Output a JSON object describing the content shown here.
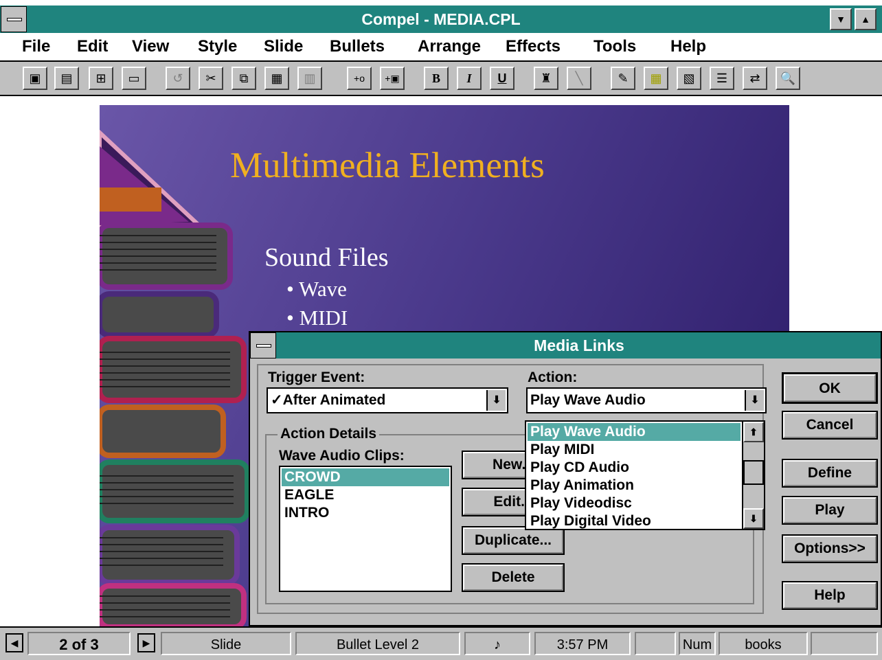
{
  "window": {
    "title": "Compel - MEDIA.CPL",
    "minimize_glyph": "▼",
    "maximize_glyph": "▲"
  },
  "menu": {
    "items": [
      {
        "label": "File"
      },
      {
        "label": "Edit"
      },
      {
        "label": "View"
      },
      {
        "label": "Style"
      },
      {
        "label": "Slide"
      },
      {
        "label": "Bullets"
      },
      {
        "label": "Arrange"
      },
      {
        "label": "Effects"
      },
      {
        "label": "Tools"
      },
      {
        "label": "Help"
      }
    ]
  },
  "toolbar": {
    "icons": [
      "save-icon",
      "print-preview-icon",
      "organize-icon",
      "drive-icon",
      "undo-icon",
      "cut-icon",
      "copy-icon",
      "paste-icon",
      "import-icon",
      "insert-text-icon",
      "insert-object-icon",
      "bold-icon",
      "italic-icon",
      "underline-icon",
      "paint-icon",
      "wand-icon",
      "edit-icon",
      "palette-icon",
      "pattern-icon",
      "lines-icon",
      "transition-icon",
      "media-link-icon"
    ],
    "bold": "B",
    "italic": "I",
    "underline": "U",
    "insert_text": "+o",
    "insert_object": "+▣"
  },
  "slide": {
    "title": "Multimedia Elements",
    "subtitle": "Sound Files",
    "bullets": [
      "• Wave",
      "• MIDI"
    ]
  },
  "dialog": {
    "title": "Media Links",
    "trigger_label": "Trigger Event:",
    "trigger_value": "✓After Animated",
    "action_label": "Action:",
    "action_value": "Play Wave Audio",
    "details_label": "Action Details",
    "clips_label": "Wave Audio Clips:",
    "clips": [
      "CROWD",
      "EAGLE",
      "INTRO"
    ],
    "selected_clip": "CROWD",
    "action_options": [
      "Play Wave Audio",
      "Play MIDI",
      "Play CD Audio",
      "Play Animation",
      "Play Videodisc",
      "Play Digital Video"
    ],
    "buttons": {
      "new": "New...",
      "edit": "Edit...",
      "duplicate": "Duplicate...",
      "delete": "Delete",
      "ok": "OK",
      "cancel": "Cancel",
      "define": "Define",
      "play": "Play",
      "options": "Options>>",
      "help": "Help"
    }
  },
  "status": {
    "page": "2 of 3",
    "view": "Slide",
    "level": "Bullet Level 2",
    "time": "3:57 PM",
    "num": "Num",
    "template": "books"
  }
}
